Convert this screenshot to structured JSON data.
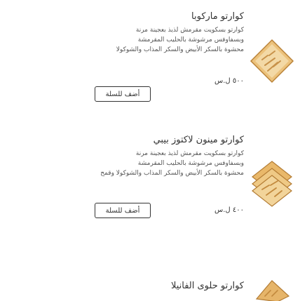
{
  "products": [
    {
      "title": "كوارتو ماركوبا",
      "description_lines": [
        "كوارتو بسكويت مقرمش لذيذ بعجينة مرنة",
        "وبسفاوفس مرشوشة بالحليب المقرمشة",
        "محشوة بالسكر الأبيض والسكر المذاب والشوكولا"
      ],
      "price": "٥٠٠ ل.س",
      "add_label": "أضف للسلة"
    },
    {
      "title": "كوارتو مينون لاكتوز بيبي",
      "description_lines": [
        "كوارتو بسكويت مقرمش لذيذ بعجينة مرنة",
        "وبسفاوفس مرشوشة بالحليب المقرمشة",
        "محشوة بالسكر الأبيض والسكر المذاب والشوكولا وقمح"
      ],
      "price": "٤٠٠ ل.س",
      "add_label": "أضف للسلة"
    },
    {
      "title": "كوارتو حلوى الفانيلا"
    }
  ],
  "colors": {
    "text": "#333333",
    "button_border": "#333333",
    "biscuit": "#d9a45a"
  }
}
